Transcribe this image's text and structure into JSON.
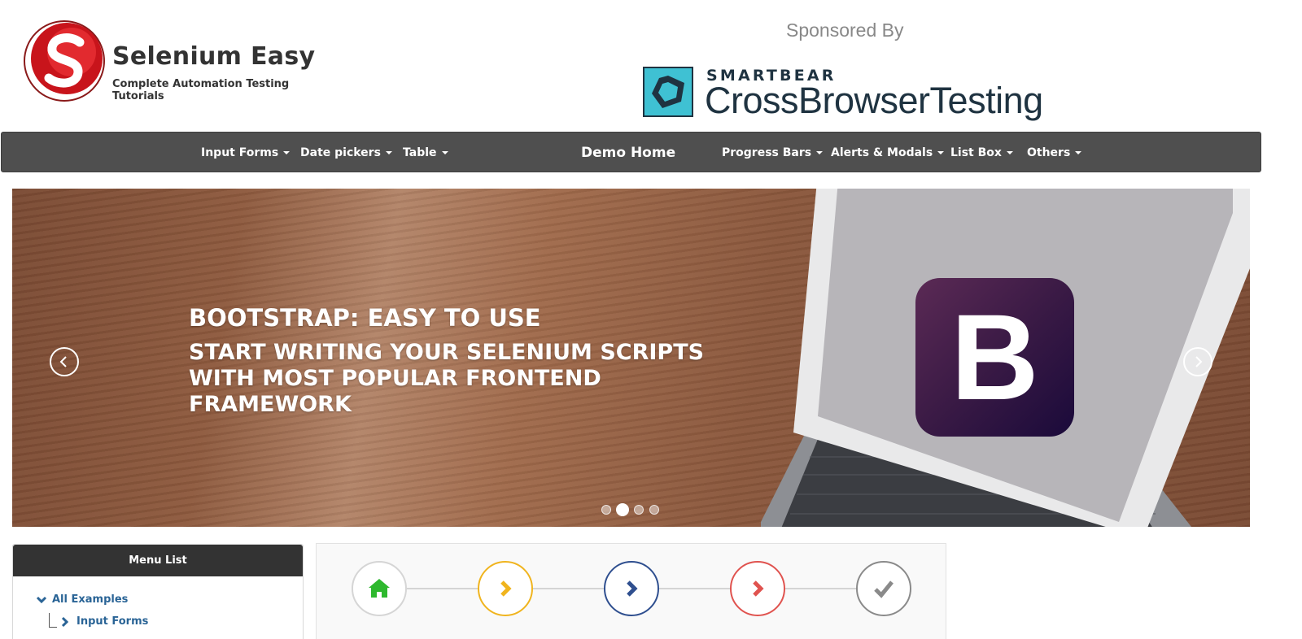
{
  "header": {
    "brand_title": "Selenium Easy",
    "brand_subtitle": "Complete Automation Testing Tutorials",
    "sponsor_label": "Sponsored By",
    "sponsor_top": "SMARTBEAR",
    "sponsor_bottom": "CrossBrowserTesting"
  },
  "nav": {
    "left": [
      "Input Forms",
      "Date pickers",
      "Table"
    ],
    "home": "Demo Home",
    "right": [
      "Progress Bars",
      "Alerts & Modals",
      "List Box",
      "Others"
    ]
  },
  "carousel": {
    "title": "BOOTSTRAP: EASY TO USE",
    "body": "START WRITING YOUR SELENIUM SCRIPTS WITH MOST POPULAR FRONTEND FRAMEWORK",
    "logo_letter": "B",
    "slide_count": 4,
    "active_slide": 2
  },
  "sidebar": {
    "heading": "Menu List",
    "items": [
      "All Examples",
      "Input Forms"
    ]
  },
  "steps": {
    "icons": [
      "home-icon",
      "chevron-right-icon",
      "chevron-right-icon",
      "chevron-right-icon",
      "check-icon"
    ],
    "colors": [
      "#2eb82e",
      "#f0b41e",
      "#2f4f8f",
      "#e0534f",
      "#8a8a8a"
    ]
  },
  "colors": {
    "navbar": "#4f4f4f",
    "menu_head": "#333333",
    "link": "#2a6496",
    "sponsor_cyan": "#3fc1d3"
  }
}
